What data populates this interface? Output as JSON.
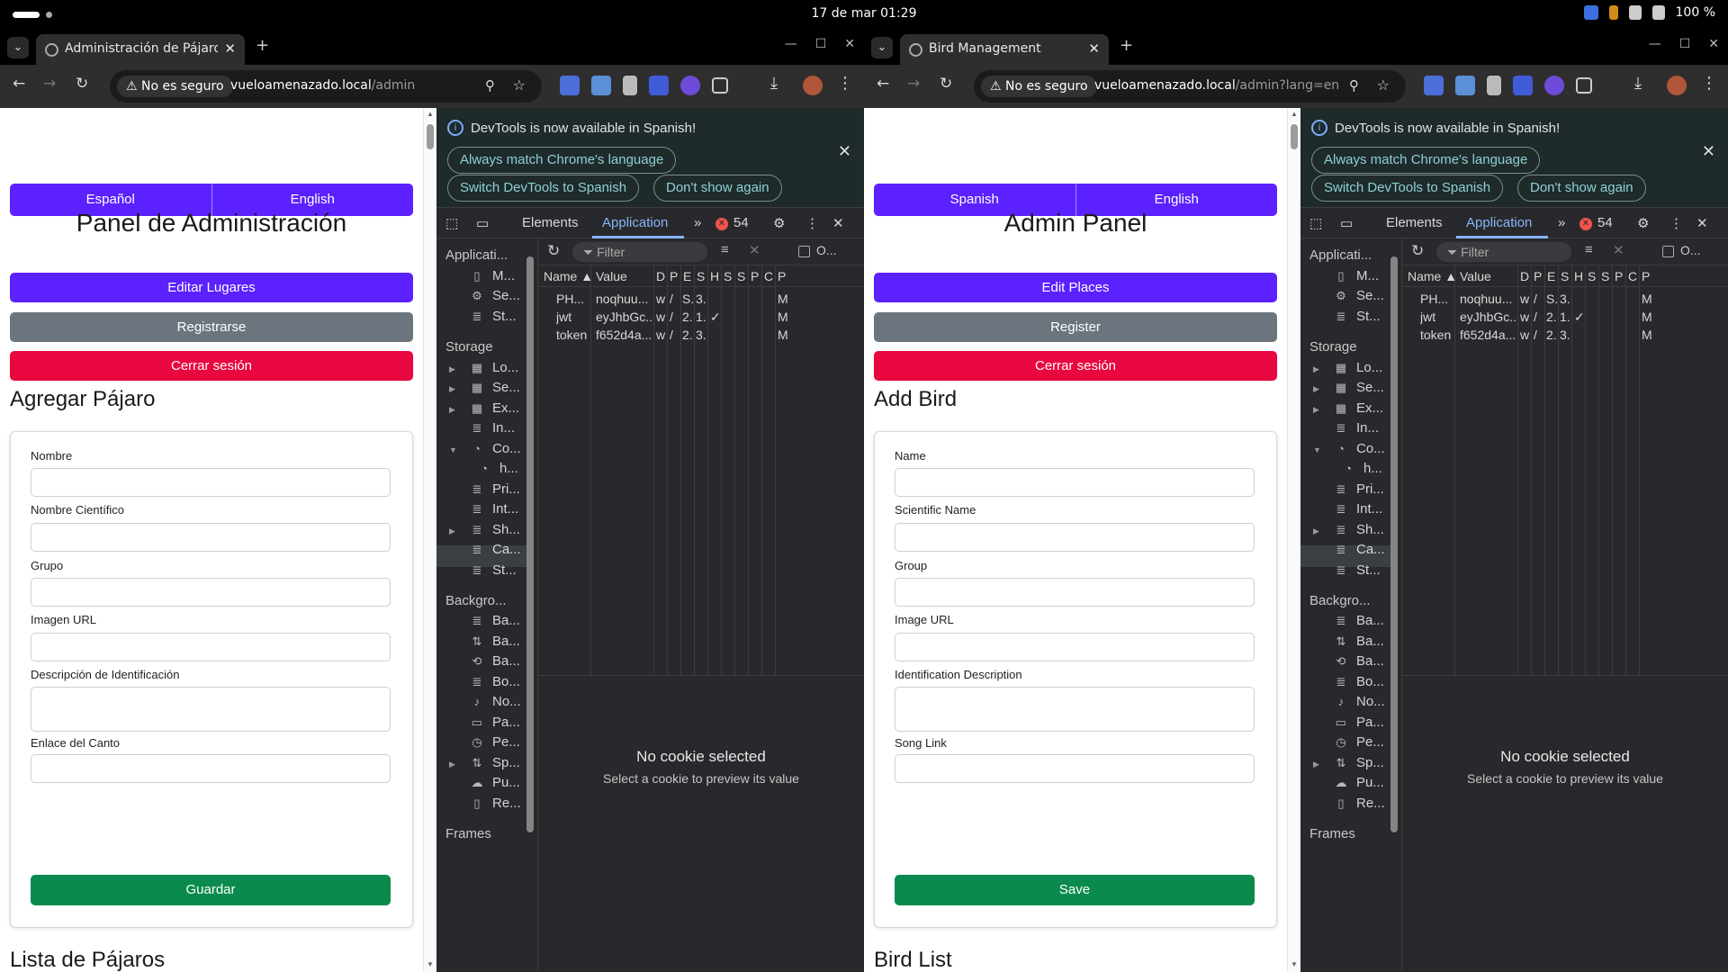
{
  "system": {
    "clock": "17 de mar  01:29",
    "battery": "100 %"
  },
  "left_window": {
    "tab_title": "Administración de Pájaros",
    "security": "No es seguro",
    "url_host": "vueloamenazado.local",
    "url_path": "/admin",
    "page": {
      "lang_es": "Español",
      "lang_en": "English",
      "title": "Panel de Administración",
      "btn_places": "Editar Lugares",
      "btn_register": "Registrarse",
      "btn_logout": "Cerrar sesión",
      "section_title": "Agregar Pájaro",
      "label_name": "Nombre",
      "label_scientific": "Nombre Científico",
      "label_group": "Grupo",
      "label_image": "Imagen URL",
      "label_description": "Descripción de Identificación",
      "label_song": "Enlace del Canto",
      "btn_save": "Guardar",
      "list_title": "Lista de Pájaros"
    }
  },
  "right_window": {
    "tab_title": "Bird Management",
    "security": "No es seguro",
    "url_host": "vueloamenazado.local",
    "url_path": "/admin?lang=en",
    "page": {
      "lang_es": "Spanish",
      "lang_en": "English",
      "title": "Admin Panel",
      "btn_places": "Edit Places",
      "btn_register": "Register",
      "btn_logout": "Cerrar sesión",
      "section_title": "Add Bird",
      "label_name": "Name",
      "label_scientific": "Scientific Name",
      "label_group": "Group",
      "label_image": "Image URL",
      "label_description": "Identification Description",
      "label_song": "Song Link",
      "btn_save": "Save",
      "list_title": "Bird List"
    }
  },
  "devtools": {
    "info_message": "DevTools is now available in Spanish!",
    "btn_match": "Always match Chrome's language",
    "btn_switch": "Switch DevTools to Spanish",
    "btn_dont_show": "Don't show again",
    "tab_elements": "Elements",
    "tab_application": "Application",
    "error_count": "54",
    "filter_placeholder": "Filter",
    "only_label": "O...",
    "sidebar": {
      "app_header": "Applicati...",
      "app_items": [
        "M...",
        "Se...",
        "St..."
      ],
      "storage_header": "Storage",
      "storage_items": [
        "Lo...",
        "Se...",
        "Ex...",
        "In...",
        "Co...",
        "h...",
        "Pri...",
        "Int...",
        "Sh...",
        "Ca...",
        "St..."
      ],
      "background_header": "Backgro...",
      "background_items": [
        "Ba...",
        "Ba...",
        "Ba...",
        "Bo...",
        "No...",
        "Pa...",
        "Pe...",
        "Sp...",
        "Pu...",
        "Re..."
      ],
      "frames_header": "Frames"
    },
    "columns": [
      "Name ▲",
      "Value",
      "D",
      "P",
      "E",
      "S",
      "H",
      "S",
      "S",
      "P",
      "C",
      "P"
    ],
    "cookies": [
      {
        "name": "PH...",
        "value": "noqhuu...",
        "d": "w",
        "p": "/",
        "e": "S.",
        "s": "3.",
        "h": "",
        "last": "M"
      },
      {
        "name": "jwt",
        "value": "eyJhbGc...",
        "d": "w",
        "p": "/",
        "e": "2.",
        "s": "1.",
        "h": "✓",
        "last": "M"
      },
      {
        "name": "token",
        "value": "f652d4a...",
        "d": "w",
        "p": "/",
        "e": "2.",
        "s": "3.",
        "h": "",
        "last": "M"
      }
    ],
    "no_cookie": "No cookie selected",
    "no_cookie_sub": "Select a cookie to preview its value"
  }
}
